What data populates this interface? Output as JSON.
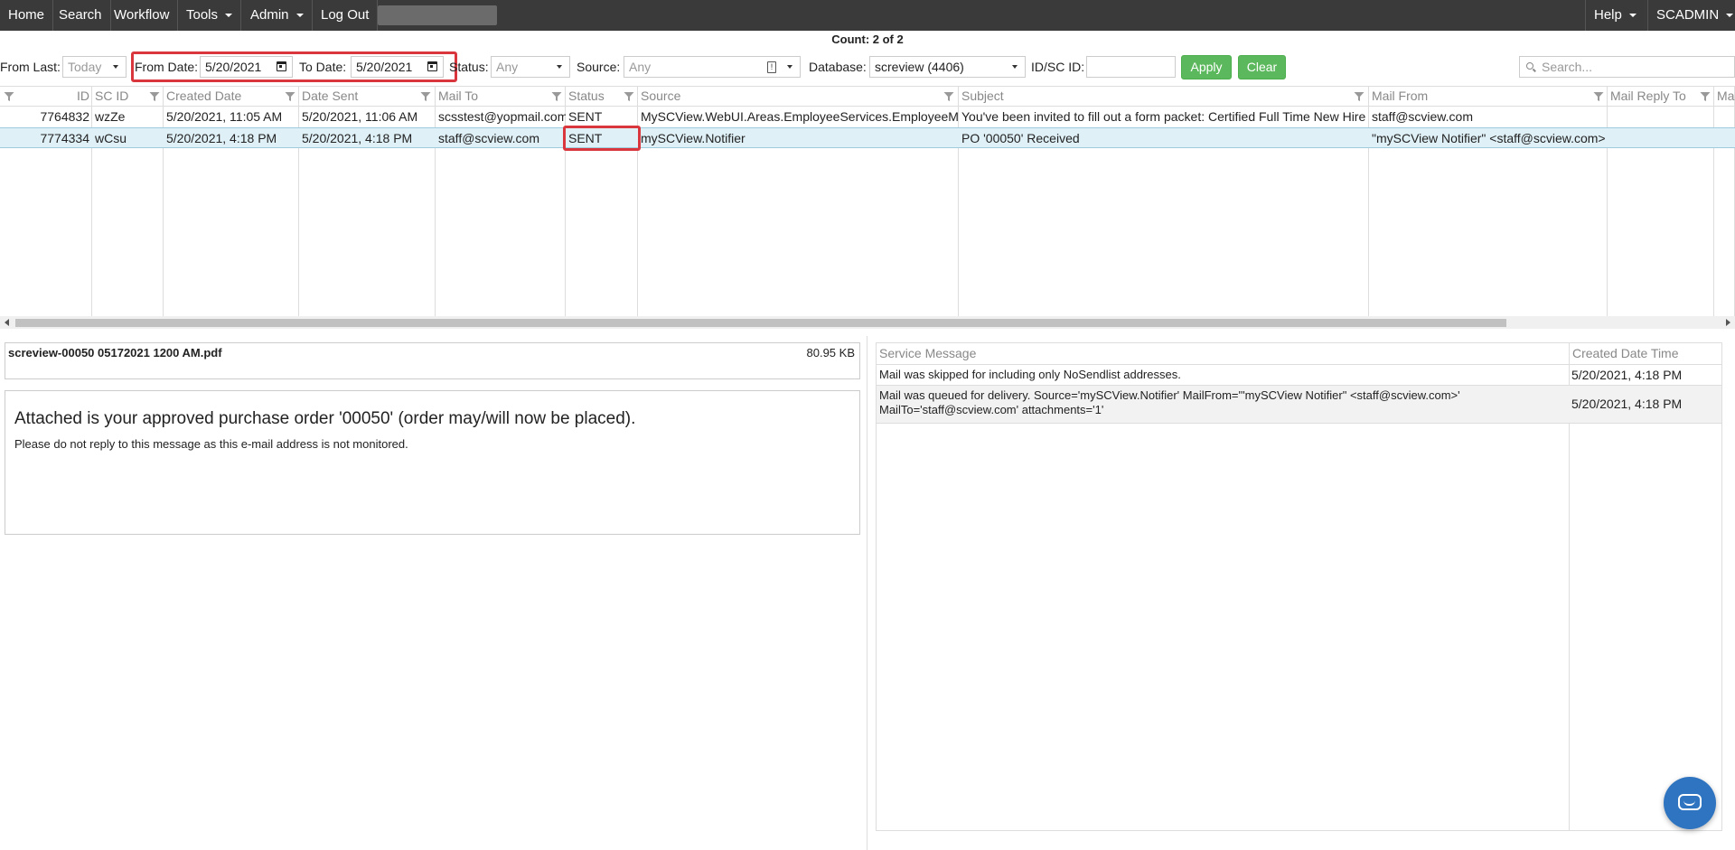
{
  "nav": {
    "items": [
      "Home",
      "Search",
      "Workflow",
      "Tools",
      "Admin",
      "Log Out"
    ],
    "help": "Help",
    "user": "SCADMIN"
  },
  "count_text": "Count: 2 of 2",
  "filters": {
    "from_last_label": "From Last:",
    "from_last_value": "Today",
    "from_date_label": "From Date:",
    "from_date_value": "5/20/2021",
    "to_date_label": "To Date:",
    "to_date_value": "5/20/2021",
    "status_label": "Status:",
    "status_value": "Any",
    "source_label": "Source:",
    "source_value": "Any",
    "database_label": "Database:",
    "database_value": "screview (4406)",
    "idsc_label": "ID/SC ID:",
    "idsc_value": "",
    "apply_label": "Apply",
    "clear_label": "Clear",
    "search_placeholder": "Search..."
  },
  "grid": {
    "columns": [
      "ID",
      "SC ID",
      "Created Date",
      "Date Sent",
      "Mail To",
      "Status",
      "Source",
      "Subject",
      "Mail From",
      "Mail Reply To",
      "Ma"
    ],
    "rows": [
      {
        "id": "7764832",
        "scid": "wzZe",
        "created": "5/20/2021, 11:05 AM",
        "sent": "5/20/2021, 11:06 AM",
        "mailto": "scsstest@yopmail.com",
        "status": "SENT",
        "source": "MySCView.WebUI.Areas.EmployeeServices.EmployeeMgr",
        "subject": "You've been invited to fill out a form packet: Certified Full Time New Hire",
        "mailfrom": "staff@scview.com",
        "replyto": ""
      },
      {
        "id": "7774334",
        "scid": "wCsu",
        "created": "5/20/2021, 4:18 PM",
        "sent": "5/20/2021, 4:18 PM",
        "mailto": "staff@scview.com",
        "status": "SENT",
        "source": "mySCView.Notifier",
        "subject": "PO '00050' Received",
        "mailfrom": "\"mySCView Notifier\" <staff@scview.com>",
        "replyto": ""
      }
    ]
  },
  "attachment": {
    "name": "screview-00050 05172021 1200 AM.pdf",
    "size": "80.95 KB"
  },
  "message": {
    "heading": "Attached is your approved purchase order '00050' (order may/will now be placed).",
    "body": "Please do not reply to this message as this e-mail address is not monitored."
  },
  "service": {
    "headers": [
      "Service Message",
      "Created Date Time"
    ],
    "rows": [
      {
        "msg": "Mail was skipped for including only NoSendlist addresses.",
        "dt": "5/20/2021, 4:18 PM"
      },
      {
        "msg": "Mail was queued for delivery. Source='mySCView.Notifier' MailFrom='\"mySCView Notifier\" <staff@scview.com>' MailTo='staff@scview.com' attachments='1'",
        "dt": "5/20/2021, 4:18 PM"
      }
    ]
  }
}
